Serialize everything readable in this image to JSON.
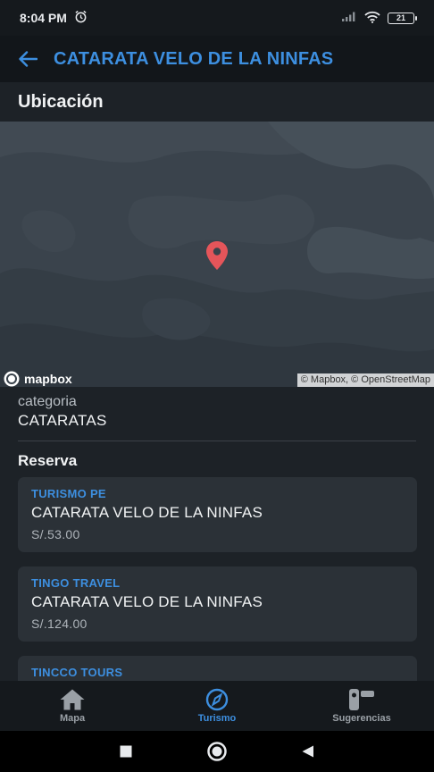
{
  "status_bar": {
    "time": "8:04 PM",
    "battery": "21"
  },
  "app_bar": {
    "title": "CATARATA VELO DE LA NINFAS"
  },
  "location_section": {
    "title": "Ubicación"
  },
  "map": {
    "logo_text": "mapbox",
    "attribution": "© Mapbox, © OpenStreetMap"
  },
  "category": {
    "label": "categoria",
    "value": "CATARATAS"
  },
  "reserva": {
    "title": "Reserva",
    "items": [
      {
        "agency": "TURISMO PE",
        "name": "CATARATA VELO DE LA NINFAS",
        "price": "S/.53.00"
      },
      {
        "agency": "TINGO TRAVEL",
        "name": "CATARATA VELO DE LA NINFAS",
        "price": "S/.124.00"
      },
      {
        "agency": "TINCCO TOURS"
      }
    ]
  },
  "bottom_nav": {
    "items": [
      {
        "label": "Mapa",
        "icon": "home-icon"
      },
      {
        "label": "Turismo",
        "icon": "compass-icon",
        "active": true
      },
      {
        "label": "Sugerencias",
        "icon": "suggestions-icon"
      }
    ]
  },
  "colors": {
    "accent": "#3d8fe0",
    "pin": "#e5555a",
    "background": "#1d2227",
    "card": "#2b3137"
  }
}
